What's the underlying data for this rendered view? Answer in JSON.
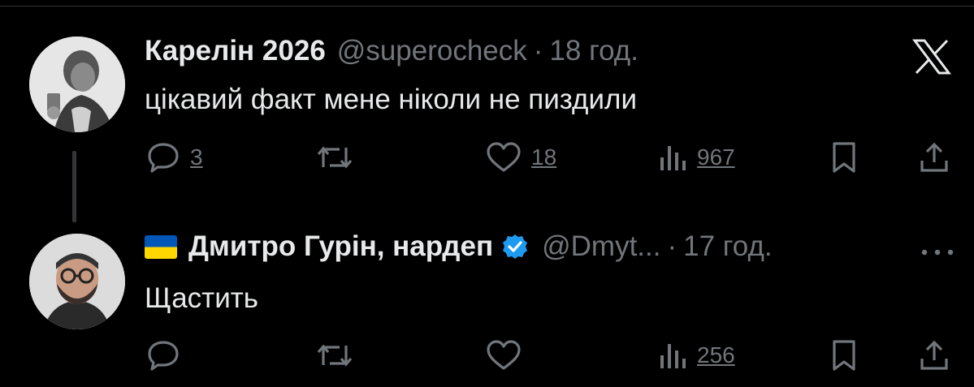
{
  "tweets": [
    {
      "author": {
        "name": "Карелін 2026",
        "handle": "@superocheck",
        "time": "18 год."
      },
      "separator": "·",
      "text": "цікавий факт мене ніколи не пиздили",
      "platform_icon": "x-logo-icon",
      "metrics": {
        "replies": "3",
        "retweets": "",
        "likes": "18",
        "views": "967"
      }
    },
    {
      "author": {
        "name": "Дмитро Гурін, нардеп",
        "handle": "@Dmyt...",
        "time": "17 год.",
        "flag": "ukraine-flag-icon",
        "verified": true
      },
      "separator": "·",
      "text": "Щастить",
      "more_icon": "more-dots-icon",
      "metrics": {
        "replies": "",
        "retweets": "",
        "likes": "",
        "views": "256"
      }
    }
  ],
  "colors": {
    "background": "#000000",
    "primary_text": "#e7e9ea",
    "secondary_text": "#71767b",
    "verified_blue": "#1d9bf0",
    "flag_blue": "#0057b7",
    "flag_yellow": "#ffd700"
  }
}
